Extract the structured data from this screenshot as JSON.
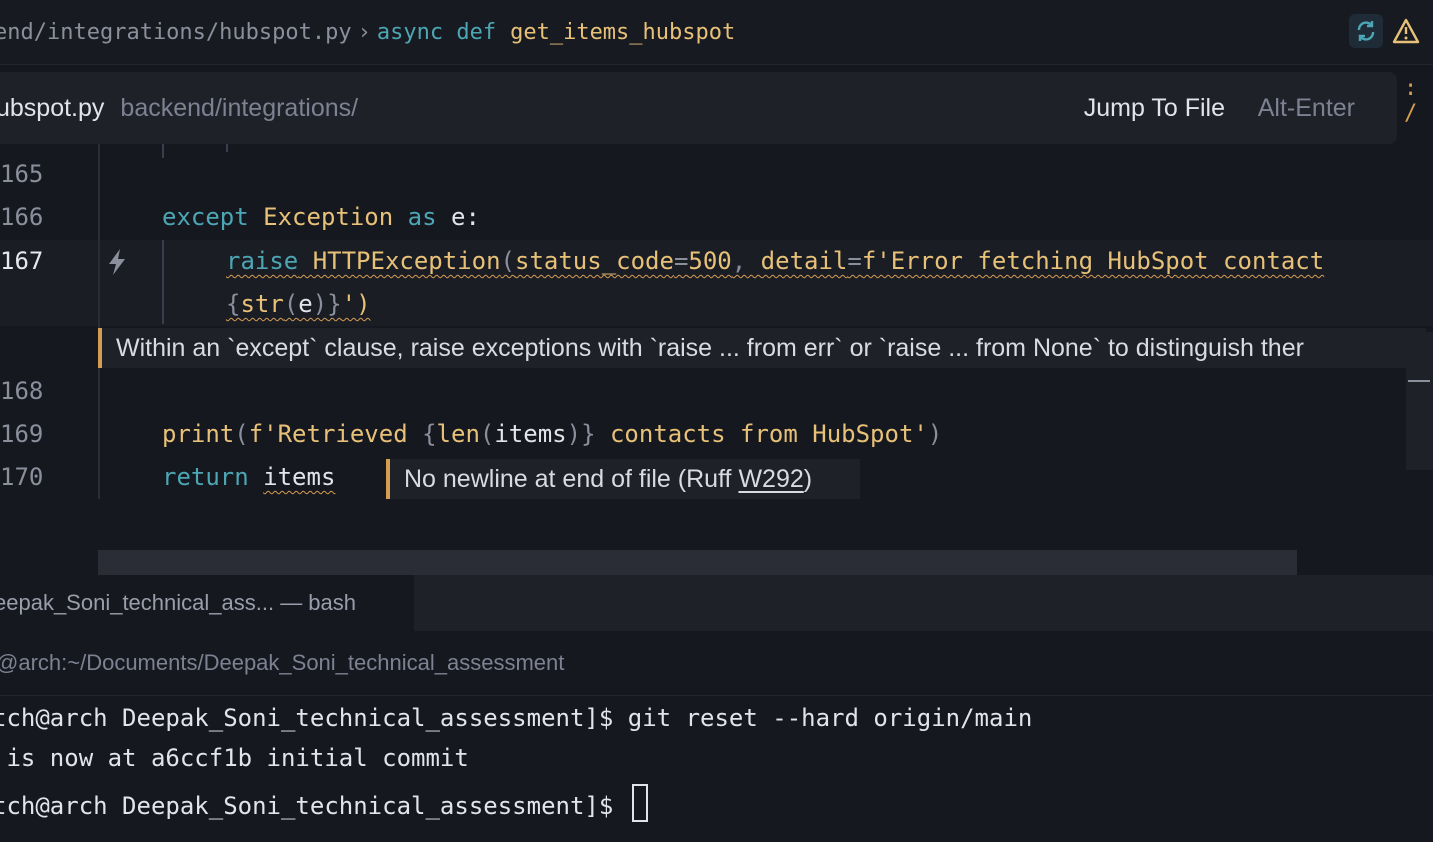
{
  "breadcrumb": {
    "path": "end/integrations/hubspot.py",
    "separator": "›",
    "keywords": "async def",
    "function": "get_items_hubspot"
  },
  "top_icons": {
    "sync": "sync-icon",
    "warning": "warning-icon"
  },
  "jump_hint": {
    "filename": "ubspot.py",
    "directory": "backend/integrations/",
    "action": "Jump To File",
    "shortcut": "Alt-Enter",
    "overflow_glyph": ": /"
  },
  "editor": {
    "lines": {
      "l165": "165",
      "l166": "166",
      "l167": "167",
      "l168": "168",
      "l169": "169",
      "l170": "170"
    },
    "code": {
      "except_kw": "except",
      "exception_cls": "Exception",
      "as_kw": "as",
      "e_var": "e:",
      "raise_kw": "raise",
      "http_exc": "HTTPException",
      "paren_open": "(",
      "status_param": "status_code",
      "eq1": "=",
      "status_val": "500",
      "comma": ",",
      "detail_param": "detail",
      "eq2": "=",
      "detail_str": "f'Error fetching HubSpot contact",
      "wrap_open": "{",
      "wrap_str": "str",
      "wrap_paren1": "(",
      "wrap_e": "e",
      "wrap_paren2": ")",
      "wrap_close": "}",
      "wrap_end": "')",
      "print_fn": "print",
      "print_open": "(",
      "print_str1": "f'Retrieved ",
      "print_brace1": "{",
      "print_len": "len",
      "print_p1": "(",
      "print_items": "items",
      "print_p2": ")",
      "print_brace2": "}",
      "print_str2": " contacts from HubSpot'",
      "print_close": ")",
      "return_kw": "return",
      "return_items": "items"
    },
    "diagnostic": "Within an `except` clause, raise exceptions with `raise ... from err` or `raise ... from None` to distinguish ther",
    "inline_diagnostic": {
      "text": "No newline at end of file (Ruff ",
      "rule": "W292",
      "end": ")"
    }
  },
  "terminal": {
    "tab_label": "eepak_Soni_technical_ass... — bash",
    "title": "@arch:~/Documents/Deepak_Soni_technical_assessment",
    "lines": [
      "tch@arch Deepak_Soni_technical_assessment]$ git reset --hard origin/main",
      " is now at a6ccf1b initial commit",
      "tch@arch Deepak_Soni_technical_assessment]$ "
    ]
  },
  "colors": {
    "background": "#16181f",
    "keyword": "#4ca6b4",
    "string": "#e8c178",
    "warning": "#d69d52"
  }
}
